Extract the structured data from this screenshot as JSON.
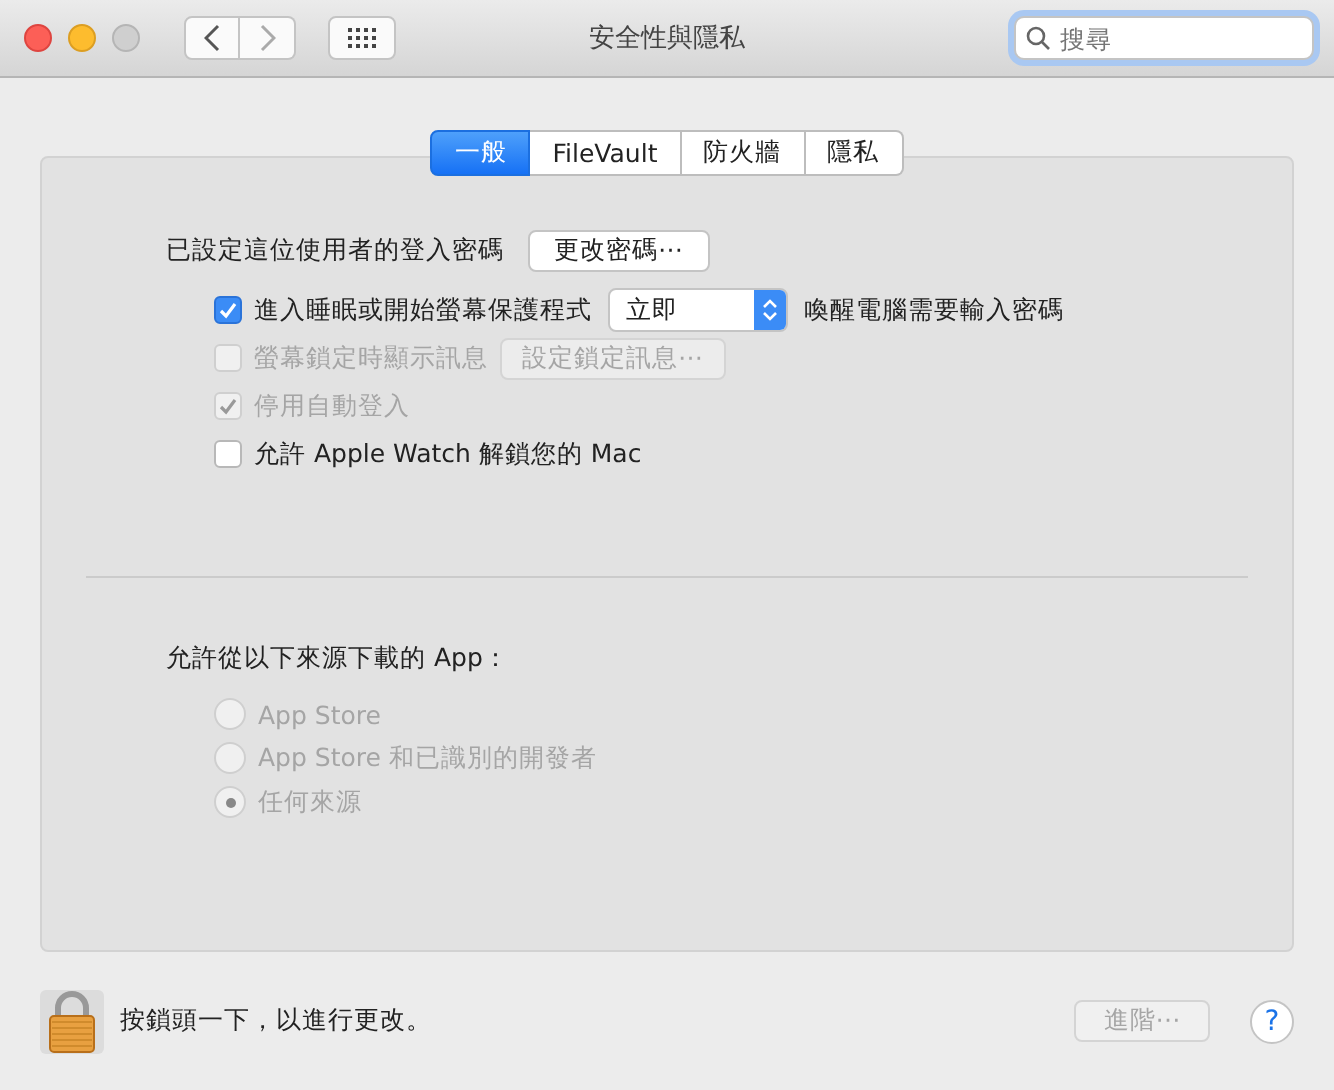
{
  "window": {
    "title": "安全性與隱私"
  },
  "search": {
    "placeholder": "搜尋"
  },
  "tabs": [
    {
      "label": "一般",
      "selected": true
    },
    {
      "label": "FileVault",
      "selected": false
    },
    {
      "label": "防火牆",
      "selected": false
    },
    {
      "label": "隱私",
      "selected": false
    }
  ],
  "password": {
    "label": "已設定這位使用者的登入密碼",
    "button": "更改密碼⋯"
  },
  "options": [
    {
      "kind": "popup",
      "label": "進入睡眠或開始螢幕保護程式",
      "checked": true,
      "disabled": false,
      "value": "立即",
      "suffix": "喚醒電腦需要輸入密碼"
    },
    {
      "kind": "button",
      "label": "螢幕鎖定時顯示訊息",
      "checked": false,
      "disabled": true,
      "button": "設定鎖定訊息⋯"
    },
    {
      "kind": "plain",
      "label": "停用自動登入",
      "checked": true,
      "disabled": true
    },
    {
      "kind": "plain",
      "label": "允許 Apple Watch 解鎖您的 Mac",
      "checked": false,
      "disabled": false
    }
  ],
  "downloads": {
    "label": "允許從以下來源下載的 App：",
    "sources": [
      {
        "label": "App Store",
        "selected": false,
        "disabled": true
      },
      {
        "label": "App Store 和已識別的開發者",
        "selected": false,
        "disabled": true
      },
      {
        "label": "任何來源",
        "selected": true,
        "disabled": true
      }
    ]
  },
  "footer": {
    "text": "按鎖頭一下，以進行更改。",
    "advanced": {
      "label": "進階⋯",
      "disabled": true
    },
    "help": "?"
  }
}
